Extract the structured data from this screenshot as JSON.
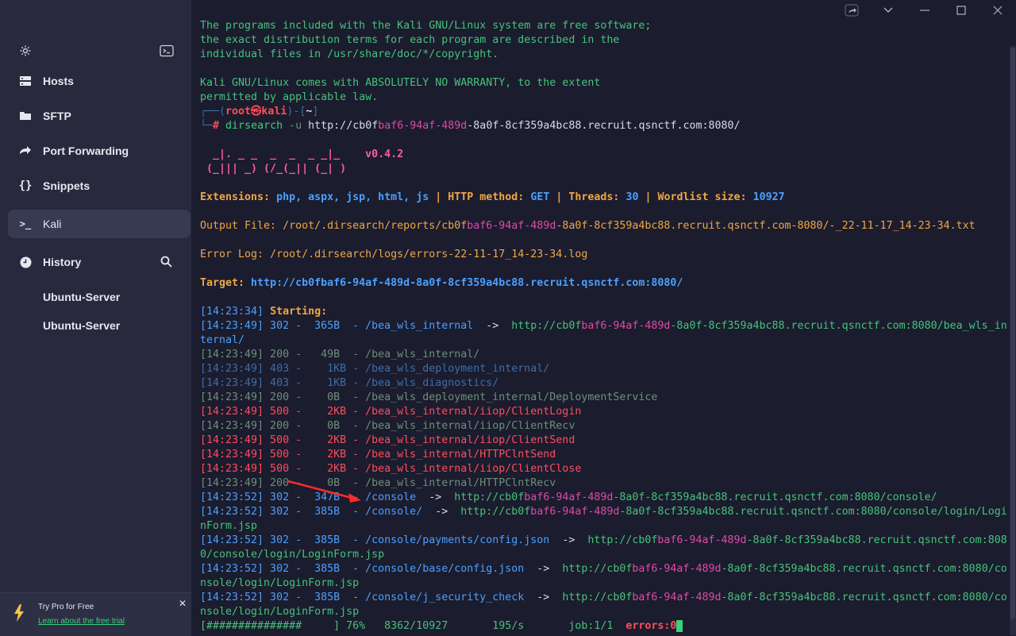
{
  "sidebar": {
    "nav": [
      {
        "label": "Hosts",
        "icon": "hosts-icon"
      },
      {
        "label": "SFTP",
        "icon": "folder-icon"
      },
      {
        "label": "Port Forwarding",
        "icon": "forward-icon"
      },
      {
        "label": "Snippets",
        "icon": "braces-icon"
      },
      {
        "label": "Kali",
        "icon": "terminal-prompt-icon",
        "active": true
      },
      {
        "label": "History",
        "icon": "clock-icon"
      }
    ],
    "history_items": [
      "Ubuntu-Server",
      "Ubuntu-Server"
    ],
    "promo": {
      "title": "Try Pro for Free",
      "link": "Learn about the free trial"
    }
  },
  "terminal": {
    "lines": [
      "The programs included with the Kali GNU/Linux system are free software;",
      "the exact distribution terms for each program are described in the",
      "individual files in /usr/share/doc/*/copyright.",
      "",
      "Kali GNU/Linux comes with ABSOLUTELY NO WARRANTY, to the extent",
      "permitted by applicable law.",
      "┌──(root㉿kali)-[~]",
      "└─# dirsearch -u http://cb0fbaf6-94af-489d-8a0f-8cf359a4bc88.recruit.qsnctf.com:8080/",
      "",
      "  _|. _ _  _  _  _ _|_    v0.4.2",
      " (_||| _) (/_(_|| (_| )",
      "",
      "Extensions: php, aspx, jsp, html, js | HTTP method: GET | Threads: 30 | Wordlist size: 10927",
      "",
      "Output File: /root/.dirsearch/reports/cb0fbaf6-94af-489d-8a0f-8cf359a4bc88.recruit.qsnctf.com-8080/-_22-11-17_14-23-34.txt",
      "",
      "Error Log: /root/.dirsearch/logs/errors-22-11-17_14-23-34.log",
      "",
      "Target: http://cb0fbaf6-94af-489d-8a0f-8cf359a4bc88.recruit.qsnctf.com:8080/",
      "",
      "[14:23:34] Starting:",
      "[14:23:49] 302 -  365B  - /bea_wls_internal  ->  http://cb0fbaf6-94af-489d-8a0f-8cf359a4bc88.recruit.qsnctf.com:8080/bea_wls_in",
      "ternal/",
      "[14:23:49] 200 -   49B  - /bea_wls_internal/",
      "[14:23:49] 403 -    1KB - /bea_wls_deployment_internal/",
      "[14:23:49] 403 -    1KB - /bea_wls_diagnostics/",
      "[14:23:49] 200 -    0B  - /bea_wls_deployment_internal/DeploymentService",
      "[14:23:49] 500 -    2KB - /bea_wls_internal/iiop/ClientLogin",
      "[14:23:49] 200 -    0B  - /bea_wls_internal/iiop/ClientRecv",
      "[14:23:49] 500 -    2KB - /bea_wls_internal/iiop/ClientSend",
      "[14:23:49] 500 -    2KB - /bea_wls_internal/HTTPClntSend",
      "[14:23:49] 500 -    2KB - /bea_wls_internal/iiop/ClientClose",
      "[14:23:49] 200 -    0B  - /bea_wls_internal/HTTPClntRecv",
      "[14:23:52] 302 -  347B  - /console  ->  http://cb0fbaf6-94af-489d-8a0f-8cf359a4bc88.recruit.qsnctf.com:8080/console/",
      "[14:23:52] 302 -  385B  - /console/  ->  http://cb0fbaf6-94af-489d-8a0f-8cf359a4bc88.recruit.qsnctf.com:8080/console/login/Logi",
      "nForm.jsp",
      "[14:23:52] 302 -  385B  - /console/payments/config.json  ->  http://cb0fbaf6-94af-489d-8a0f-8cf359a4bc88.recruit.qsnctf.com:808",
      "0/console/login/LoginForm.jsp",
      "[14:23:52] 302 -  385B  - /console/base/config.json  ->  http://cb0fbaf6-94af-489d-8a0f-8cf359a4bc88.recruit.qsnctf.com:8080/co",
      "nsole/login/LoginForm.jsp",
      "[14:23:52] 302 -  385B  - /console/j_security_check  ->  http://cb0fbaf6-94af-489d-8a0f-8cf359a4bc88.recruit.qsnctf.com:8080/co",
      "nsole/login/LoginForm.jsp",
      "[###############     ] 76%   8362/10927       195/s       job:1/1  errors:0"
    ]
  }
}
